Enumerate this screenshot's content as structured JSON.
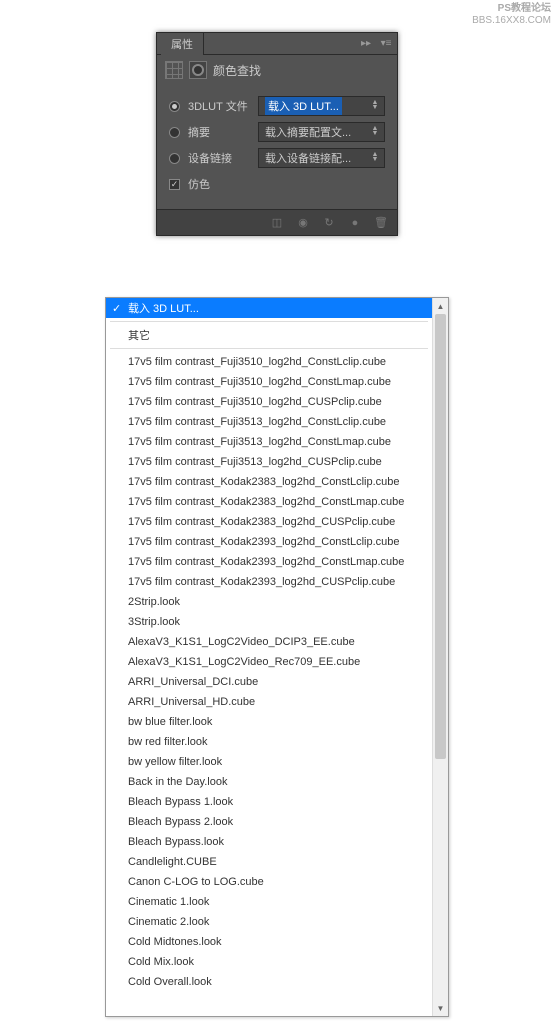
{
  "watermark": {
    "line1": "PS教程论坛",
    "line2": "BBS.16XX8.COM"
  },
  "panel": {
    "tab": "属性",
    "title": "颜色查找",
    "rows": {
      "lut3d": {
        "label": "3DLUT 文件",
        "value": "载入 3D LUT..."
      },
      "abstract": {
        "label": "摘要",
        "value": "载入摘要配置文..."
      },
      "devicelink": {
        "label": "设备链接",
        "value": "载入设备链接配..."
      },
      "dither": {
        "label": "仿色"
      }
    }
  },
  "dropdown": {
    "selected": "载入 3D LUT...",
    "other": "其它",
    "items": [
      "17v5 film contrast_Fuji3510_log2hd_ConstLclip.cube",
      "17v5 film contrast_Fuji3510_log2hd_ConstLmap.cube",
      "17v5 film contrast_Fuji3510_log2hd_CUSPclip.cube",
      "17v5 film contrast_Fuji3513_log2hd_ConstLclip.cube",
      "17v5 film contrast_Fuji3513_log2hd_ConstLmap.cube",
      "17v5 film contrast_Fuji3513_log2hd_CUSPclip.cube",
      "17v5 film contrast_Kodak2383_log2hd_ConstLclip.cube",
      "17v5 film contrast_Kodak2383_log2hd_ConstLmap.cube",
      "17v5 film contrast_Kodak2383_log2hd_CUSPclip.cube",
      "17v5 film contrast_Kodak2393_log2hd_ConstLclip.cube",
      "17v5 film contrast_Kodak2393_log2hd_ConstLmap.cube",
      "17v5 film contrast_Kodak2393_log2hd_CUSPclip.cube",
      "2Strip.look",
      "3Strip.look",
      "AlexaV3_K1S1_LogC2Video_DCIP3_EE.cube",
      "AlexaV3_K1S1_LogC2Video_Rec709_EE.cube",
      "ARRI_Universal_DCI.cube",
      "ARRI_Universal_HD.cube",
      "bw blue filter.look",
      "bw red filter.look",
      "bw yellow filter.look",
      "Back in the Day.look",
      "Bleach Bypass 1.look",
      "Bleach Bypass 2.look",
      "Bleach Bypass.look",
      "Candlelight.CUBE",
      "Canon C-LOG to LOG.cube",
      "Cinematic 1.look",
      "Cinematic 2.look",
      "Cold Midtones.look",
      "Cold Mix.look",
      "Cold Overall.look"
    ]
  }
}
